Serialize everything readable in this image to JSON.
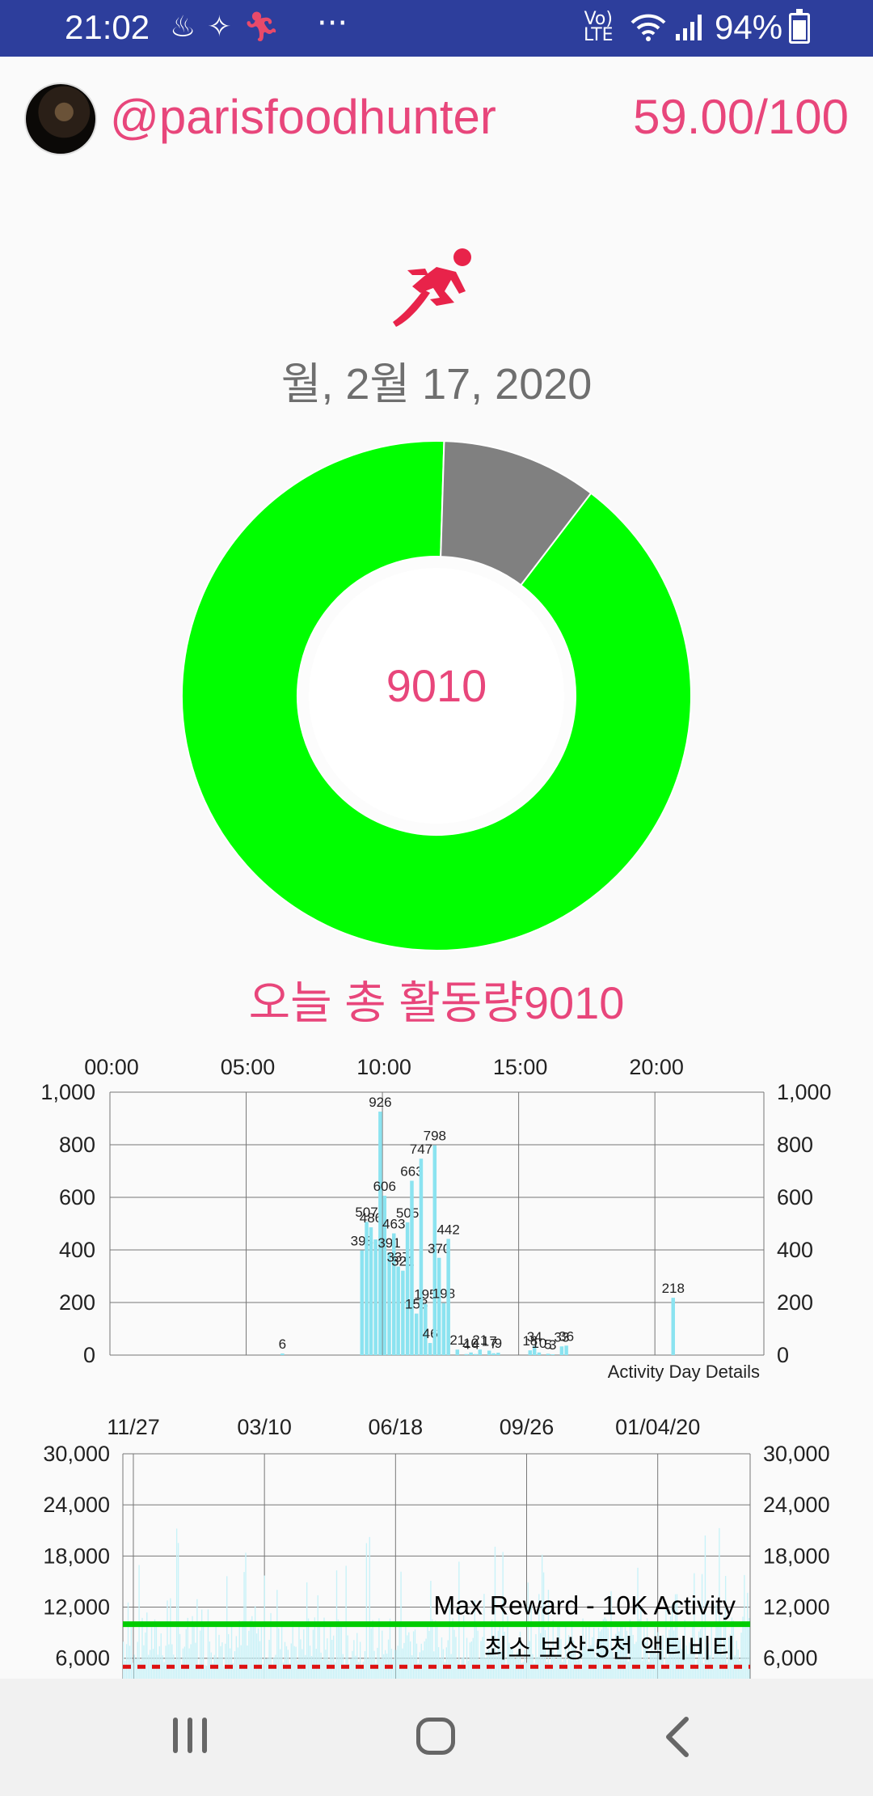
{
  "status_bar": {
    "time": "21:02",
    "left_icons": [
      "notification-icon",
      "cleaner-icon",
      "runner-small-icon"
    ],
    "more": "···",
    "network_top": "Vo)",
    "network_bottom": "LTE",
    "battery": "94%"
  },
  "header": {
    "username": "@parisfoodhunter",
    "score": "59.00/100"
  },
  "date": "월, 2월 17, 2020",
  "donut": {
    "center_value": "9010",
    "progress_fraction": 0.901,
    "colors": {
      "progress": "#00ff00",
      "remainder": "#808080",
      "inner_ring": "#7cf37c"
    }
  },
  "total_label": "오늘 총 활동량9010",
  "colors": {
    "accent": "#e8467b",
    "bar": "#8be3f0",
    "max_line": "#00cc00",
    "min_line": "#dd1111",
    "statusbar": "#2d3e9c"
  },
  "chart_data": [
    {
      "type": "bar",
      "title": "Activity Day Details",
      "x_range_hours": [
        0,
        24
      ],
      "x_tick_labels": [
        "00:00",
        "05:00",
        "10:00",
        "15:00",
        "20:00"
      ],
      "x_tick_hours": [
        0,
        5,
        10,
        15,
        20
      ],
      "ylim": [
        0,
        1000
      ],
      "y_ticks": [
        "1,000",
        "800",
        "600",
        "400",
        "200",
        "0"
      ],
      "y_tick_values": [
        1000,
        800,
        600,
        400,
        200,
        0
      ],
      "grid": true,
      "bars": [
        {
          "h": 6.33,
          "v": 6,
          "label": "6"
        },
        {
          "h": 9.25,
          "v": 398,
          "label": "398"
        },
        {
          "h": 9.42,
          "v": 507,
          "label": "507"
        },
        {
          "h": 9.58,
          "v": 486,
          "label": "486"
        },
        {
          "h": 9.75,
          "v": 440,
          "label": ""
        },
        {
          "h": 9.92,
          "v": 926,
          "label": "926"
        },
        {
          "h": 10.08,
          "v": 606,
          "label": "606"
        },
        {
          "h": 10.25,
          "v": 391,
          "label": "391"
        },
        {
          "h": 10.42,
          "v": 463,
          "label": "463"
        },
        {
          "h": 10.58,
          "v": 337,
          "label": "337"
        },
        {
          "h": 10.75,
          "v": 321,
          "label": "321"
        },
        {
          "h": 10.92,
          "v": 505,
          "label": "505"
        },
        {
          "h": 11.08,
          "v": 663,
          "label": "663"
        },
        {
          "h": 11.25,
          "v": 158,
          "label": "158"
        },
        {
          "h": 11.42,
          "v": 747,
          "label": "747"
        },
        {
          "h": 11.58,
          "v": 195,
          "label": "195"
        },
        {
          "h": 11.75,
          "v": 46,
          "label": "46"
        },
        {
          "h": 11.92,
          "v": 798,
          "label": "798"
        },
        {
          "h": 12.08,
          "v": 370,
          "label": "370"
        },
        {
          "h": 12.25,
          "v": 198,
          "label": "198"
        },
        {
          "h": 12.42,
          "v": 442,
          "label": "442"
        },
        {
          "h": 12.75,
          "v": 21,
          "label": "21"
        },
        {
          "h": 13.08,
          "v": 4,
          "label": "4"
        },
        {
          "h": 13.25,
          "v": 10,
          "label": "10"
        },
        {
          "h": 13.42,
          "v": 4,
          "label": "4"
        },
        {
          "h": 13.58,
          "v": 21,
          "label": "21"
        },
        {
          "h": 13.92,
          "v": 17,
          "label": "17"
        },
        {
          "h": 14.08,
          "v": 7,
          "label": "7"
        },
        {
          "h": 14.25,
          "v": 9,
          "label": "9"
        },
        {
          "h": 15.42,
          "v": 18,
          "label": "18"
        },
        {
          "h": 15.58,
          "v": 34,
          "label": "34"
        },
        {
          "h": 15.75,
          "v": 10,
          "label": "10"
        },
        {
          "h": 16.08,
          "v": 5,
          "label": "5"
        },
        {
          "h": 16.25,
          "v": 3,
          "label": "3"
        },
        {
          "h": 16.58,
          "v": 33,
          "label": "33"
        },
        {
          "h": 16.75,
          "v": 36,
          "label": "36"
        },
        {
          "h": 20.67,
          "v": 218,
          "label": "218"
        }
      ]
    },
    {
      "type": "bar",
      "x_tick_labels": [
        "11/27",
        "03/10",
        "06/18",
        "09/26",
        "01/04/20"
      ],
      "ylim": [
        0,
        30000
      ],
      "y_ticks": [
        "30,000",
        "24,000",
        "18,000",
        "12,000",
        "6,000"
      ],
      "y_tick_values": [
        30000,
        24000,
        18000,
        12000,
        6000
      ],
      "grid": true,
      "reference_lines": [
        {
          "label": "Max Reward - 10K Activity",
          "value": 10000,
          "style": "solid"
        },
        {
          "label": "최소 보상-5천 액티비티",
          "value": 5000,
          "style": "dashed"
        }
      ]
    }
  ],
  "nav_bar": {
    "buttons": [
      "recents",
      "home",
      "back"
    ]
  }
}
